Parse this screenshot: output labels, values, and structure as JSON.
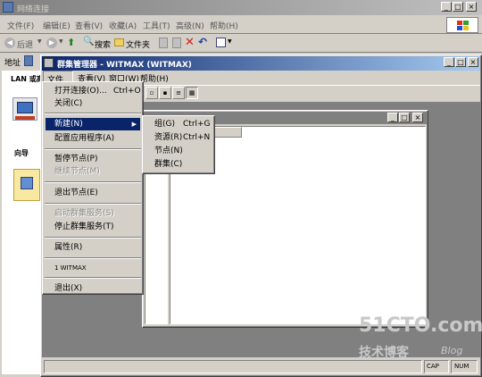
{
  "outer": {
    "title": "网络连接",
    "menu": [
      "文件(F)",
      "编辑(E)",
      "查看(V)",
      "收藏(A)",
      "工具(T)",
      "高级(N)",
      "帮助(H)"
    ],
    "toolbar": {
      "back": "后退",
      "search": "搜索",
      "folders": "文件夹"
    },
    "address_label": "地址",
    "left_heading": "LAN 或高",
    "wizard_label": "向导"
  },
  "app": {
    "title": "群集管理器 - WITMAX (WITMAX)",
    "menu": [
      "文件(F)",
      "查看(V)",
      "窗口(W)",
      "帮助(H)"
    ]
  },
  "file_menu": {
    "open_connection": "打开连接(O)...",
    "open_connection_shortcut": "Ctrl+O",
    "close": "关闭(C)",
    "new": "新建(N)",
    "configure_app": "配置应用程序(A)",
    "pause_node": "暂停节点(P)",
    "resume_node": "继续节点(M)",
    "evict_node": "退出节点(E)",
    "start_service": "启动群集服务(S)",
    "stop_service": "停止群集服务(T)",
    "properties": "属性(R)",
    "recent": "1 WITMAX",
    "exit": "退出(X)"
  },
  "new_submenu": {
    "group": "组(G)",
    "group_shortcut": "Ctrl+G",
    "resource": "资源(R)",
    "resource_shortcut": "Ctrl+N",
    "node": "节点(N)",
    "cluster": "群集(C)"
  },
  "status": {
    "cap": "CAP",
    "num": "NUM"
  },
  "watermark": {
    "brand": "51CTO.com",
    "sub": "技术博客",
    "blog": "Blog"
  },
  "colors": {
    "active_title": "#0a246a",
    "inactive_title": "#808080",
    "highlight": "#0a246a",
    "face": "#d4d0c8"
  }
}
